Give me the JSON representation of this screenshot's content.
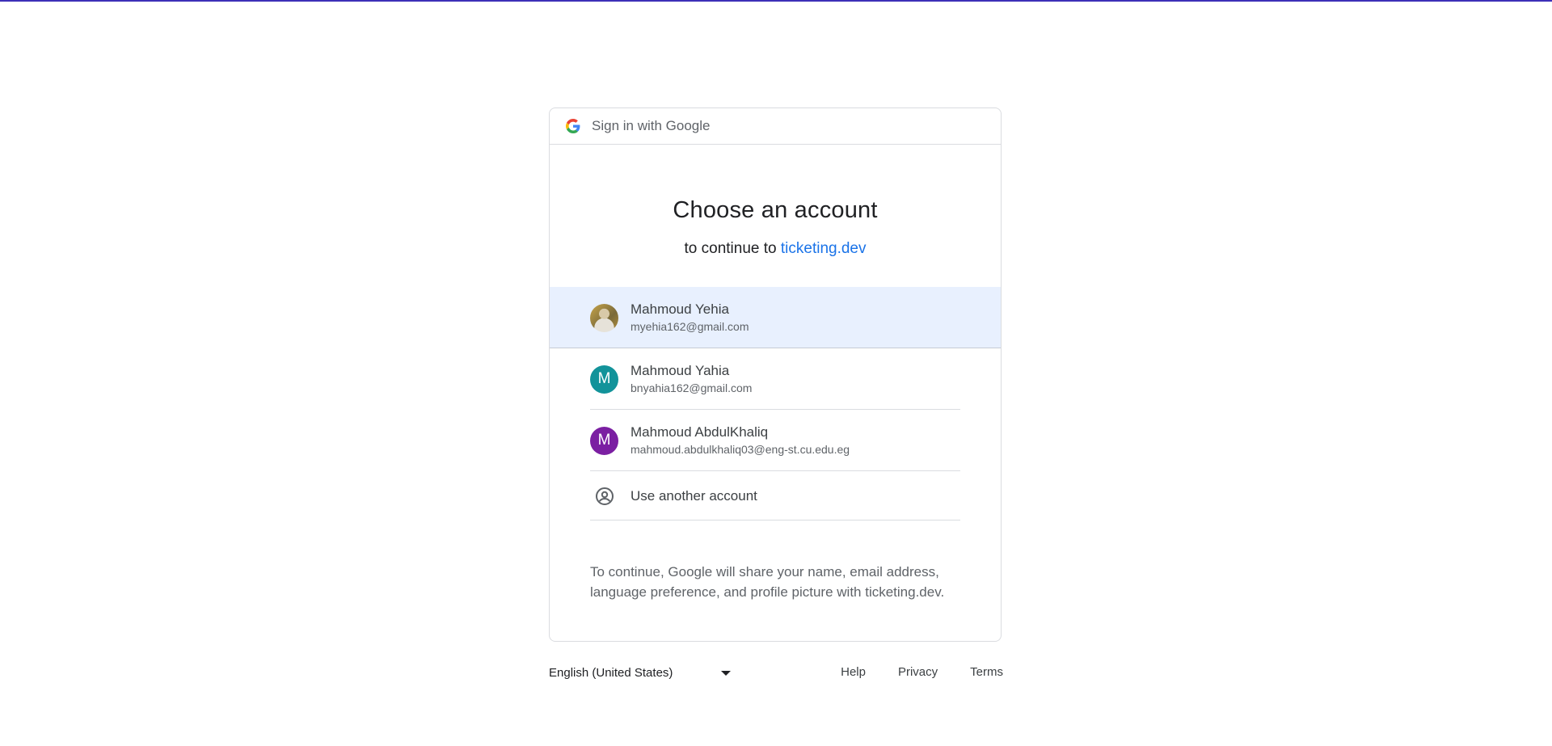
{
  "header": {
    "title": "Sign in with Google"
  },
  "main": {
    "heading": "Choose an account",
    "subheading_prefix": "to continue to ",
    "subheading_link": "ticketing.dev"
  },
  "accounts": [
    {
      "name": "Mahmoud Yehia",
      "email": "myehia162@gmail.com",
      "avatar_type": "photo",
      "selected": true
    },
    {
      "name": "Mahmoud Yahia",
      "email": "bnyahia162@gmail.com",
      "avatar_letter": "M",
      "avatar_color": "#12939a"
    },
    {
      "name": "Mahmoud AbdulKhaliq",
      "email": "mahmoud.abdulkhaliq03@eng-st.cu.edu.eg",
      "avatar_letter": "M",
      "avatar_color": "#7b1fa2"
    }
  ],
  "use_another": {
    "label": "Use another account",
    "icon": "account-circle-icon"
  },
  "disclaimer": "To continue, Google will share your name, email address, language preference, and profile picture with ticketing.dev.",
  "footer": {
    "language": "English (United States)",
    "links": [
      "Help",
      "Privacy",
      "Terms"
    ]
  },
  "colors": {
    "link": "#1a73e8",
    "selected_bg": "#e8f0fe",
    "top_bar": "#3d2fb8"
  }
}
